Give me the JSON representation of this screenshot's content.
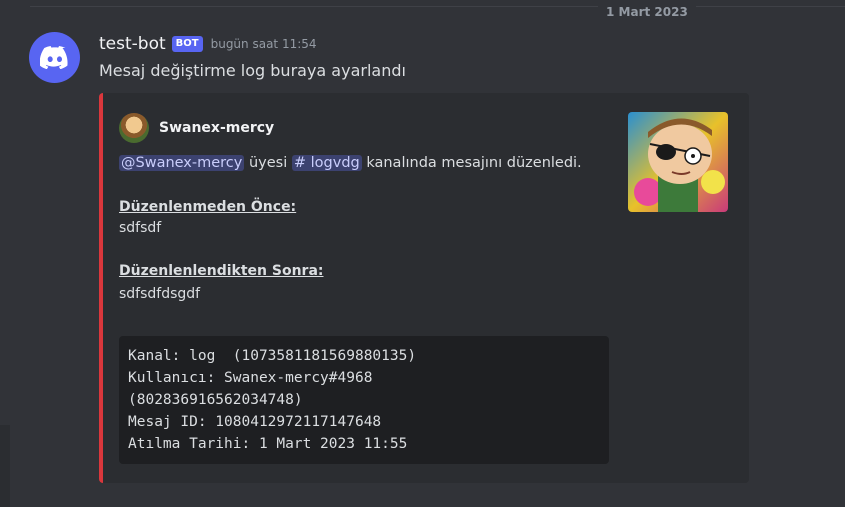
{
  "date_divider": "1 Mart 2023",
  "message": {
    "username": "test-bot",
    "bot_badge": "BOT",
    "timestamp": "bugün saat 11:54",
    "text": "Mesaj değiştirme log buraya ayarlandı"
  },
  "embed": {
    "accent_color": "#da373c",
    "author_name": "Swanex-mercy",
    "description": {
      "user_mention": "@Swanex-mercy",
      "middle_text": " üyesi ",
      "channel_mention": "logvdg",
      "end_text": " kanalında mesajını düzenledi."
    },
    "fields": [
      {
        "title": "Düzenlenmeden Önce:",
        "value": "sdfsdf"
      },
      {
        "title": "Düzenlenlendikten Sonra:",
        "value": "sdfsdfdsgdf"
      }
    ],
    "code_lines": [
      "Kanal: log  (1073581181569880135)",
      "Kullanıcı: Swanex-mercy#4968",
      "(802836916562034748)",
      "Mesaj ID: 1080412972117147648",
      "Atılma Tarihi: 1 Mart 2023 11:55"
    ]
  },
  "colors": {
    "background": "#313338",
    "embed_background": "#2b2d31",
    "blurple": "#5865f2",
    "codeblock_background": "#1e1f22"
  },
  "icons": {
    "bot_avatar": "discord-logo-icon",
    "channel_mention": "hashtag-icon"
  }
}
